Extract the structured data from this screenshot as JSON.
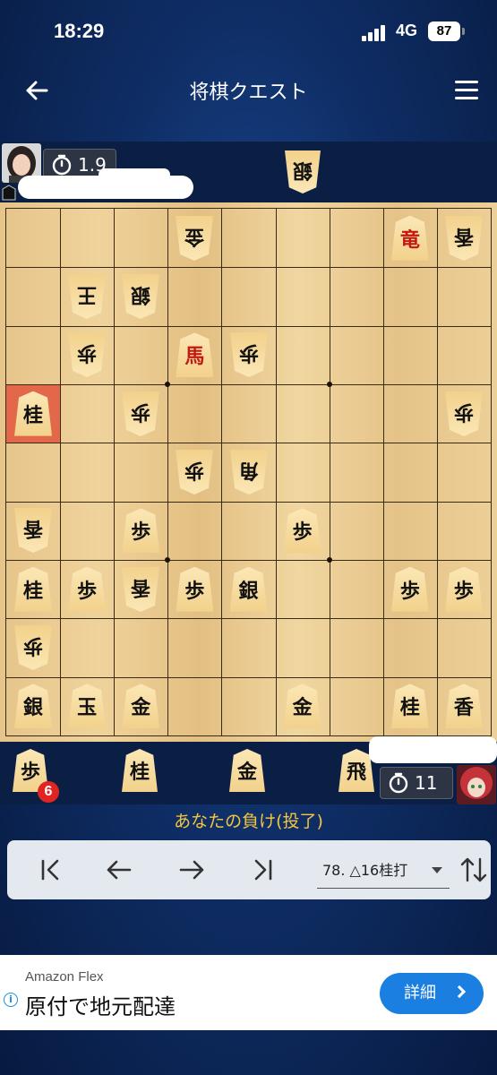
{
  "status": {
    "time": "18:29",
    "network": "4G",
    "battery": "87"
  },
  "header": {
    "title": "将棋クエスト"
  },
  "opponent": {
    "timer": "1.9"
  },
  "self": {
    "timer": "11"
  },
  "board": {
    "columns": 9,
    "rows": 9,
    "highlight": {
      "col": 1,
      "row": 4
    },
    "pieces": [
      {
        "c": 4,
        "r": 1,
        "t": "金",
        "side": "opp"
      },
      {
        "c": 8,
        "r": 1,
        "t": "竜",
        "side": "self",
        "red": true
      },
      {
        "c": 9,
        "r": 1,
        "t": "香",
        "side": "opp"
      },
      {
        "c": 2,
        "r": 2,
        "t": "王",
        "side": "opp"
      },
      {
        "c": 3,
        "r": 2,
        "t": "銀",
        "side": "opp"
      },
      {
        "c": 2,
        "r": 3,
        "t": "歩",
        "side": "opp"
      },
      {
        "c": 4,
        "r": 3,
        "t": "馬",
        "side": "self",
        "red": true
      },
      {
        "c": 5,
        "r": 3,
        "t": "歩",
        "side": "opp"
      },
      {
        "c": 1,
        "r": 4,
        "t": "桂",
        "side": "self"
      },
      {
        "c": 3,
        "r": 4,
        "t": "歩",
        "side": "opp"
      },
      {
        "c": 9,
        "r": 4,
        "t": "歩",
        "side": "opp"
      },
      {
        "c": 4,
        "r": 5,
        "t": "歩",
        "side": "opp"
      },
      {
        "c": 5,
        "r": 5,
        "t": "角",
        "side": "opp"
      },
      {
        "c": 1,
        "r": 6,
        "t": "香",
        "side": "opp"
      },
      {
        "c": 3,
        "r": 6,
        "t": "歩",
        "side": "self"
      },
      {
        "c": 6,
        "r": 6,
        "t": "歩",
        "side": "self"
      },
      {
        "c": 1,
        "r": 7,
        "t": "桂",
        "side": "self"
      },
      {
        "c": 2,
        "r": 7,
        "t": "歩",
        "side": "self"
      },
      {
        "c": 3,
        "r": 7,
        "t": "香",
        "side": "opp"
      },
      {
        "c": 4,
        "r": 7,
        "t": "歩",
        "side": "self"
      },
      {
        "c": 5,
        "r": 7,
        "t": "銀",
        "side": "self"
      },
      {
        "c": 8,
        "r": 7,
        "t": "歩",
        "side": "self"
      },
      {
        "c": 9,
        "r": 7,
        "t": "歩",
        "side": "self"
      },
      {
        "c": 1,
        "r": 8,
        "t": "歩",
        "side": "opp"
      },
      {
        "c": 1,
        "r": 9,
        "t": "銀",
        "side": "self"
      },
      {
        "c": 2,
        "r": 9,
        "t": "玉",
        "side": "self"
      },
      {
        "c": 3,
        "r": 9,
        "t": "金",
        "side": "self"
      },
      {
        "c": 6,
        "r": 9,
        "t": "金",
        "side": "self"
      },
      {
        "c": 8,
        "r": 9,
        "t": "桂",
        "side": "self"
      },
      {
        "c": 9,
        "r": 9,
        "t": "香",
        "side": "self"
      }
    ]
  },
  "opponent_hand": [
    {
      "t": "銀"
    }
  ],
  "self_hand": [
    {
      "t": "歩",
      "count": "6"
    },
    {
      "t": "桂"
    },
    {
      "t": "金"
    },
    {
      "t": "飛"
    }
  ],
  "result_text": "あなたの負け(投了)",
  "controls": {
    "move": "78. △16桂打"
  },
  "ad": {
    "brand": "Amazon Flex",
    "text": "原付で地元配達",
    "button": "詳細"
  }
}
